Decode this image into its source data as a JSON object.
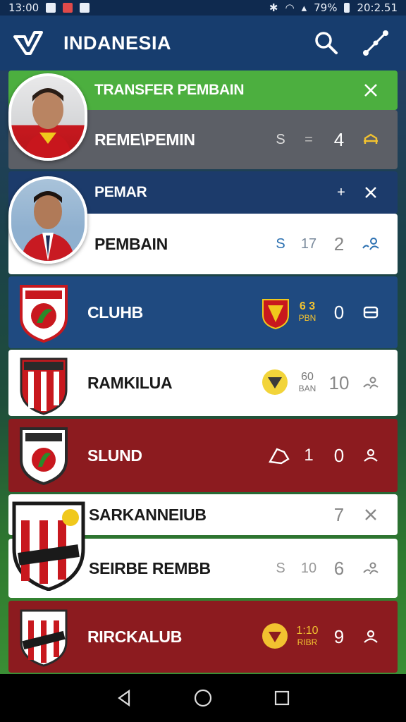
{
  "status": {
    "time": "13:00",
    "battery": "79%",
    "clock_right": "20:2.51"
  },
  "appbar": {
    "title": "INDANESIA"
  },
  "rows": [
    {
      "name": "TRANSFER PEMBAIN"
    },
    {
      "name": "REME\\PEMIN",
      "s1": "S",
      "s2": "=",
      "n": "4"
    },
    {
      "name": "PEMAR",
      "s1": "+"
    },
    {
      "name": "PEMBAIN",
      "s1": "S",
      "s2": "17",
      "n": "2"
    },
    {
      "name": "CLUHB",
      "s_top": "6 3",
      "s_bot": "PBN",
      "n": "0"
    },
    {
      "name": "RAMKILUA",
      "s_top": "60",
      "s_bot": "BAN",
      "n": "10"
    },
    {
      "name": "SLUND",
      "s2": "1",
      "n": "0"
    },
    {
      "name": "SARKANNEIUB",
      "n": "7"
    },
    {
      "name": "SEIRBE REMBB",
      "s1": "S",
      "s2": "10",
      "n": "6"
    },
    {
      "name": "RIRCKALUB",
      "s_top": "1:10",
      "s_bot": "RIBR",
      "n": "9"
    }
  ],
  "colors": {
    "green": "#4caf3f",
    "navy": "#1c3b6b",
    "maroon": "#8c1b1f",
    "appbar": "#173d6e"
  },
  "icons": [
    "app-logo-icon",
    "search-icon",
    "share-icon",
    "close-icon",
    "person-icon",
    "list-icon",
    "back-icon",
    "home-icon",
    "recents-icon"
  ]
}
